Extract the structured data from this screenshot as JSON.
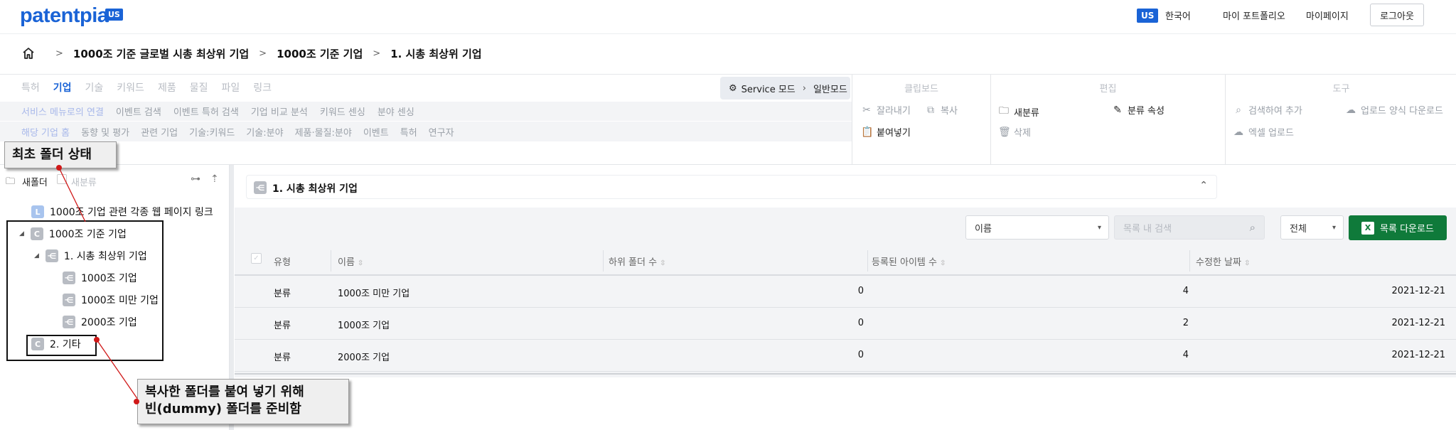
{
  "header": {
    "logo": "patentpia",
    "logo_badge": "US",
    "lang_badge": "US",
    "lang_label": "한국어",
    "links": [
      "마이 포트폴리오",
      "마이페이지"
    ],
    "logout": "로그아웃"
  },
  "breadcrumb": {
    "items": [
      "1000조 기준 글로벌 시총 최상위 기업",
      "1000조 기준 기업",
      "1. 시총 최상위 기업"
    ],
    "separator": ">"
  },
  "menu": {
    "tabs": [
      "특허",
      "기업",
      "기술",
      "키워드",
      "제품",
      "물질",
      "파일",
      "링크"
    ],
    "active_tab": "기업",
    "service_mode": {
      "left": "Service 모드",
      "right": "일반모드"
    },
    "sub_row1": [
      "서비스 메뉴로의 연결",
      "이벤트 검색",
      "이벤트 특허 검색",
      "기업 비교 분석",
      "키워드 센싱",
      "분야 센싱"
    ],
    "sub_row2": [
      "해당 기업 홈",
      "동향 및 평가",
      "관련 기업",
      "기술:키워드",
      "기술:분야",
      "제품·물질:분야",
      "이벤트",
      "특허",
      "연구자"
    ]
  },
  "tools": {
    "clipboard": {
      "title": "클립보드",
      "cut": "잘라내기",
      "copy": "복사",
      "paste": "붙여넣기"
    },
    "edit": {
      "title": "편집",
      "new_category": "새분류",
      "category_props": "분류 속성",
      "delete": "삭제"
    },
    "tool": {
      "title": "도구",
      "search_add": "검색하여 추가",
      "upload_template": "업로드 양식 다운로드",
      "excel_upload": "엑셀 업로드"
    }
  },
  "tree": {
    "new_folder": "새폴더",
    "new_category": "새분류",
    "nodes": [
      {
        "icon": "L",
        "label": "1000조 기업 관련 각종 웹 페이지 링크"
      },
      {
        "icon": "C",
        "label": "1000조 기준 기업"
      },
      {
        "icon": "E",
        "label": "1. 시총 최상위 기업"
      },
      {
        "icon": "E",
        "label": "1000조 기업"
      },
      {
        "icon": "E",
        "label": "1000조 미만 기업"
      },
      {
        "icon": "E",
        "label": "2000조 기업"
      },
      {
        "icon": "C",
        "label": "2. 기타"
      }
    ]
  },
  "main": {
    "folder_title": "1. 시총 최상위 기업",
    "sort_select": "이름",
    "search_placeholder": "목록 내 검색",
    "filter_select": "전체",
    "download_button": "목록 다운로드",
    "columns": [
      "유형",
      "이름",
      "하위 폴더 수",
      "등록된 아이템 수",
      "수정한 날짜"
    ],
    "rows": [
      {
        "type": "분류",
        "name": "1000조 미만 기업",
        "subfolders": "0",
        "items": "4",
        "modified": "2021-12-21"
      },
      {
        "type": "분류",
        "name": "1000조 기업",
        "subfolders": "0",
        "items": "2",
        "modified": "2021-12-21"
      },
      {
        "type": "분류",
        "name": "2000조 기업",
        "subfolders": "0",
        "items": "4",
        "modified": "2021-12-21"
      }
    ]
  },
  "annotations": {
    "initial_state": "최초 폴더 상태",
    "dummy_line1": "복사한 폴더를 붙여 넣기 위해",
    "dummy_line2": "빈(dummy) 폴더를 준비함"
  },
  "colors": {
    "brand": "#1a63d6",
    "download_green": "#0f7a3a",
    "annotation_red": "#d01818"
  }
}
